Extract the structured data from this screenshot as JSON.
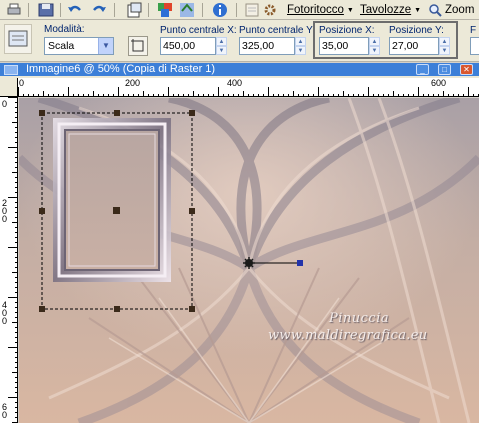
{
  "toolbar": {
    "fotoritocco_label": "Fotoritocco",
    "tavolozze_label": "Tavolozze",
    "zoom_label": "Zoom",
    "fotoritocco_mnemonic_hint": "F",
    "tavolozze_mnemonic_hint": "T"
  },
  "options": {
    "modalita_label": "Modalità:",
    "modalita_value": "Scala",
    "center_x_label": "Punto centrale X:",
    "center_x_value": "450,00",
    "center_y_label": "Punto centrale Y:",
    "center_y_value": "325,00",
    "pos_x_label": "Posizione X:",
    "pos_x_value": "35,00",
    "pos_y_label": "Posizione Y:",
    "pos_y_value": "27,00",
    "trailing_label": "F"
  },
  "window": {
    "title": "Immagine6 @ 50% (Copia di Raster 1)"
  },
  "ruler_top": [
    "0",
    "200",
    "400",
    "600"
  ],
  "ruler_left": [
    "0",
    "2",
    "0",
    "0",
    "4",
    "0",
    "0",
    "6",
    "0"
  ],
  "watermark": {
    "line1": "Pinuccia",
    "line2": "www.maldiregrafica.eu"
  },
  "colors": {
    "accent_blue": "#3c7fd8",
    "canvas_base": "#c4a89b",
    "frame": "#8a8390"
  },
  "icons": [
    "save-icon",
    "undo-icon",
    "redo-icon",
    "paste-icon",
    "layers-icon",
    "info-icon",
    "script-icon",
    "settings-icon",
    "zoom-icon"
  ]
}
